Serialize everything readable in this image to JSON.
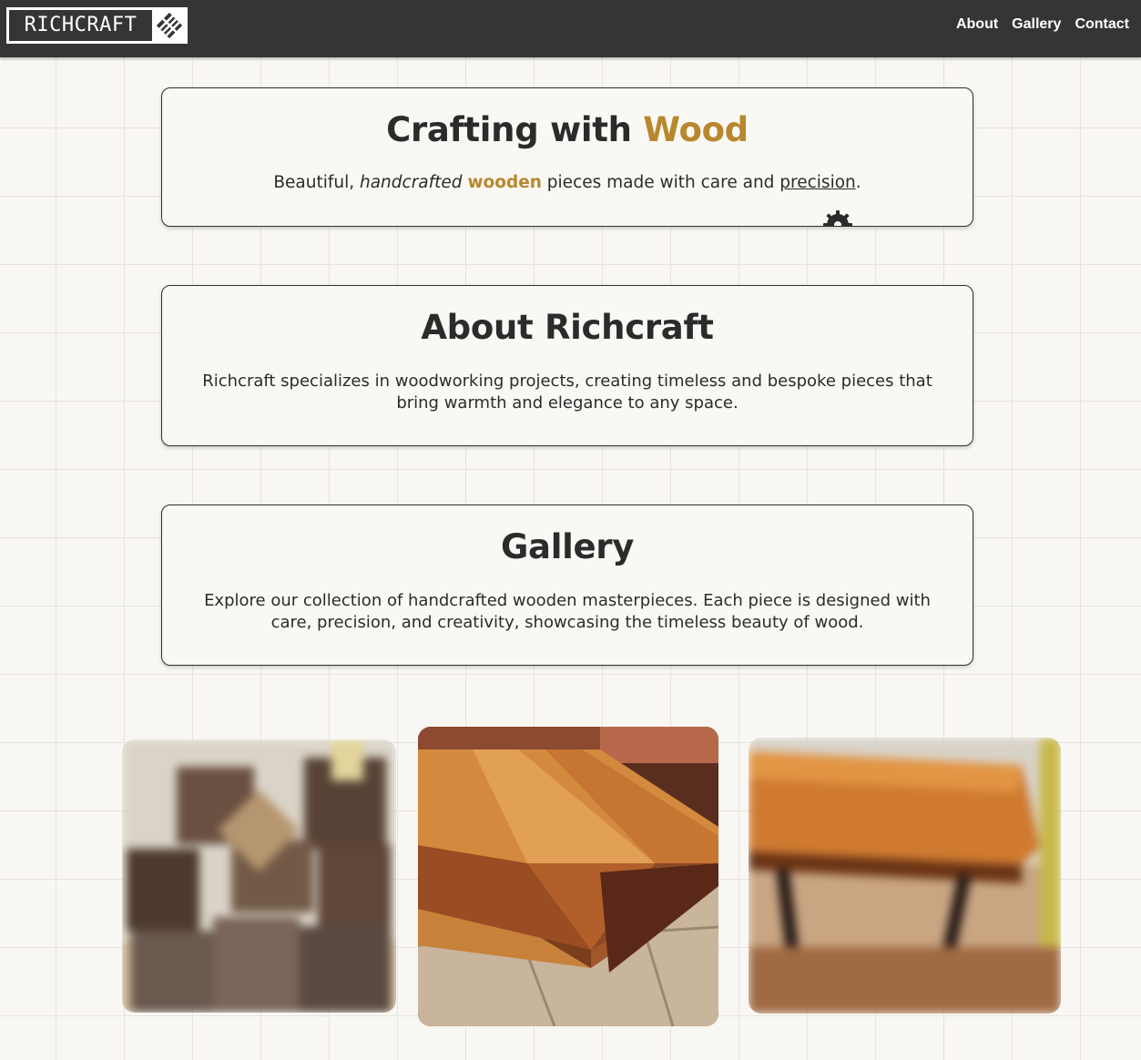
{
  "nav": {
    "logo_text": "RICHCRAFT",
    "links": [
      {
        "label": "About"
      },
      {
        "label": "Gallery"
      },
      {
        "label": "Contact"
      }
    ]
  },
  "hero": {
    "title_main": "Crafting with ",
    "title_accent": "Wood",
    "sub_1": "Beautiful, ",
    "sub_em": "handcrafted",
    "sub_2": " ",
    "sub_strong": "wooden",
    "sub_3": " pieces made with care and ",
    "sub_link": "precision",
    "sub_4": "."
  },
  "about": {
    "title": "About Richcraft",
    "text": "Richcraft specializes in woodworking projects, creating timeless and bespoke pieces that bring warmth and elegance to any space."
  },
  "gallery": {
    "title": "Gallery",
    "text": "Explore our collection of handcrafted wooden masterpieces. Each piece is designed with care, precision, and creativity, showcasing the timeless beauty of wood."
  },
  "photos": [
    {
      "subject": "wooden boxes photo",
      "state": "blurred"
    },
    {
      "subject": "cutting boards photo",
      "state": "focused"
    },
    {
      "subject": "live-edge table photo",
      "state": "blurred"
    }
  ],
  "colors": {
    "accent": "#b8872e",
    "navbar": "#353535",
    "background": "#f9f7f3",
    "text": "#2b2b2b"
  },
  "icons": [
    "logo-diamond-icon",
    "gear-icon"
  ]
}
